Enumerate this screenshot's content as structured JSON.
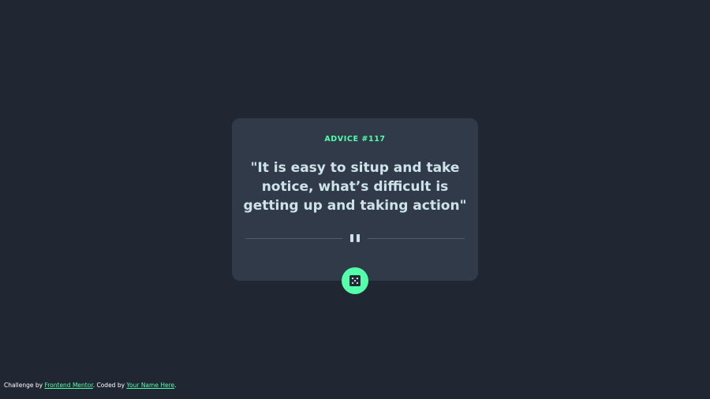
{
  "advice": {
    "id_label": "ADVICE #117",
    "quote": "\"It is easy to situp and take notice, what’s difficult is getting up and taking action\""
  },
  "dice_button": {
    "icon": "dice-icon"
  },
  "colors": {
    "background": "#202632",
    "card": "#313a48",
    "accent": "#53ffaa",
    "text": "#cee3e9",
    "divider": "#4f5d74"
  },
  "attribution": {
    "prefix": "Challenge by ",
    "frontend_link": "Frontend Mentor",
    "middle": ". Coded by ",
    "author_link": "Your Name Here",
    "suffix": "."
  }
}
